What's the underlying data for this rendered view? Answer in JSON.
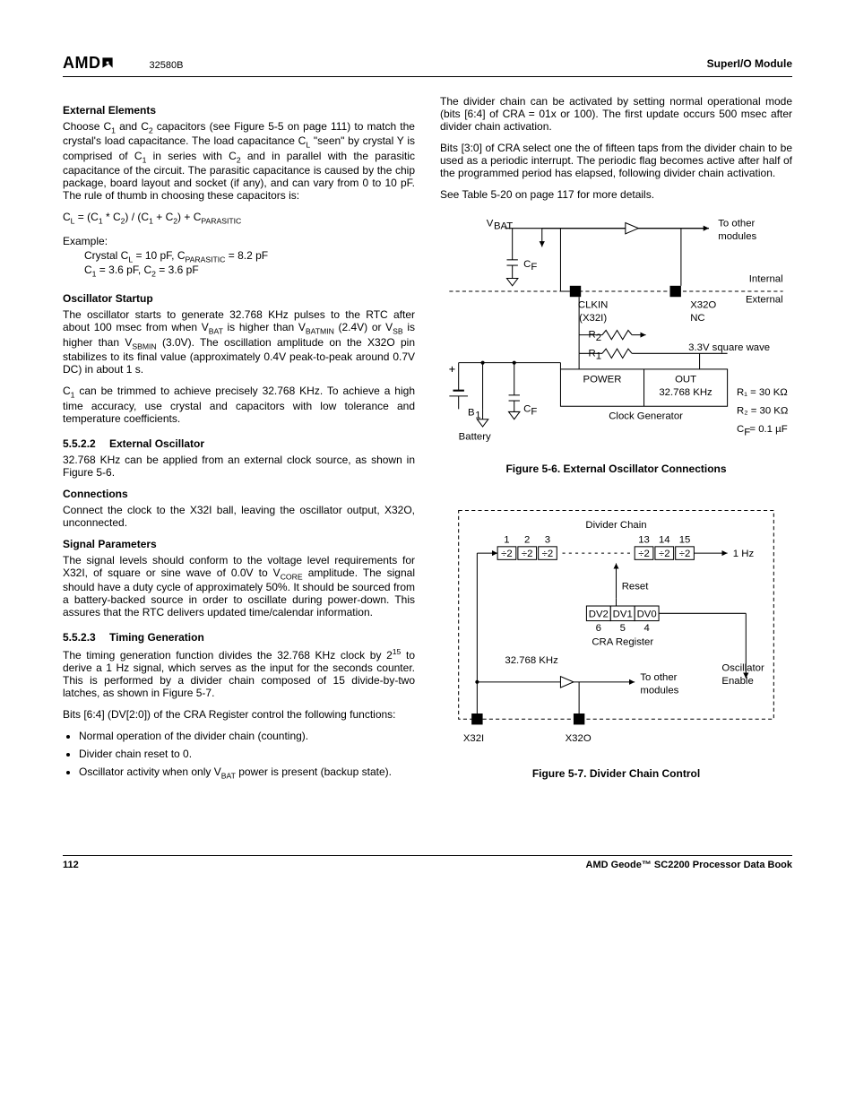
{
  "header": {
    "logo": "AMD",
    "docnum": "32580B",
    "right": "SuperI/O Module"
  },
  "left": {
    "h_ext_elements": "External Elements",
    "p_ext_elements": "Choose C₁ and C₂ capacitors (see Figure 5-5 on page 111) to match the crystal's load capacitance. The load capacitance C_L \"seen\" by crystal Y is comprised of C₁ in series with C₂ and in parallel with the parasitic capacitance of the circuit. The parasitic capacitance is caused by the chip package, board layout and socket (if any), and can vary from 0 to 10 pF. The rule of thumb in choosing these capacitors is:",
    "formula": "C_L = (C₁ * C₂) / (C₁ + C₂) + C_PARASITIC",
    "example_label": "Example:",
    "example_l1": "Crystal C_L = 10 pF, C_PARASITIC = 8.2 pF",
    "example_l2": "C₁ = 3.6 pF, C₂ = 3.6 pF",
    "h_osc_start": "Oscillator Startup",
    "p_osc_start": "The oscillator starts to generate 32.768 KHz pulses to the RTC after about 100 msec from when V_BAT is higher than V_BATMIN (2.4V) or V_SB is higher than V_SBMIN (3.0V). The oscillation amplitude on the X32O pin stabilizes to its final value (approximately 0.4V peak-to-peak around 0.7V DC) in about 1 s.",
    "p_osc_trim": "C₁ can be trimmed to achieve precisely 32.768 KHz. To achieve a high time accuracy, use crystal and capacitors with low tolerance and temperature coefficients.",
    "sec_ext_osc_num": "5.5.2.2",
    "sec_ext_osc_title": "External Oscillator",
    "p_ext_osc": "32.768 KHz can be applied from an external clock source, as shown in Figure 5-6.",
    "h_conn": "Connections",
    "p_conn": "Connect the clock to the X32I ball, leaving the oscillator output, X32O, unconnected.",
    "h_sig": "Signal Parameters",
    "p_sig": "The signal levels should conform to the voltage level requirements for X32I, of square or sine wave of 0.0V to V_CORE amplitude. The signal should have a duty cycle of approximately 50%. It should be sourced from a battery-backed source in order to oscillate during power-down. This assures that the RTC delivers updated time/calendar information.",
    "sec_timing_num": "5.5.2.3",
    "sec_timing_title": "Timing Generation",
    "p_timing": "The timing generation function divides the 32.768 KHz clock by 2¹⁵ to derive a 1 Hz signal, which serves as the input for the seconds counter. This is performed by a divider chain composed of 15 divide-by-two latches, as shown in Figure 5-7.",
    "p_bits": "Bits [6:4] (DV[2:0]) of the CRA Register control the following functions:",
    "bul1": "Normal operation of the divider chain (counting).",
    "bul2": "Divider chain reset to 0.",
    "bul3": "Oscillator activity when only V_BAT power is present (backup state)."
  },
  "right": {
    "p_activate": "The divider chain can be activated by setting normal operational mode (bits [6:4] of CRA = 01x or 100). The first update occurs 500 msec after divider chain activation.",
    "p_taps": "Bits [3:0] of CRA select one the of fifteen taps from the divider chain to be used as a periodic interrupt. The periodic flag becomes active after half of the programmed period has elapsed, following divider chain activation.",
    "p_see": "See Table 5-20 on page 117 for more details.",
    "fig56_caption": "Figure 5-6.  External Oscillator Connections",
    "fig57_caption": "Figure 5-7.  Divider Chain Control"
  },
  "fig56": {
    "vbat": "V_BAT",
    "cf": "C_F",
    "clkin": "CLKIN",
    "x32i": "(X32I)",
    "x32o": "X32O",
    "nc": "NC",
    "to_other": "To other",
    "modules": "modules",
    "internal": "Internal",
    "external": "External",
    "r2": "R₂",
    "r1": "R₁",
    "sqwave": "3.3V square wave",
    "power": "POWER",
    "out": "OUT",
    "clkgen1": "32.768 KHz",
    "clkgen2": "Clock Generator",
    "b1": "B₁",
    "battery": "Battery",
    "r1v": "R₁ = 30 KΩ",
    "r2v": "R₂ = 30 KΩ",
    "cfv": "C_F = 0.1 µF"
  },
  "fig57": {
    "divchain": "Divider Chain",
    "n1": "1",
    "n2": "2",
    "n3": "3",
    "n13": "13",
    "n14": "14",
    "n15": "15",
    "d2": "÷2",
    "hz1": "1 Hz",
    "reset": "Reset",
    "dv2": "DV2",
    "dv1": "DV1",
    "dv0": "DV0",
    "b6": "6",
    "b5": "5",
    "b4": "4",
    "cra": "CRA Register",
    "khz": "32.768 KHz",
    "to_other": "To other",
    "modules": "modules",
    "osc": "Oscillator",
    "enable": "Enable",
    "x32i": "X32I",
    "x32o": "X32O"
  },
  "footer": {
    "page": "112",
    "book": "AMD Geode™ SC2200  Processor Data Book"
  }
}
